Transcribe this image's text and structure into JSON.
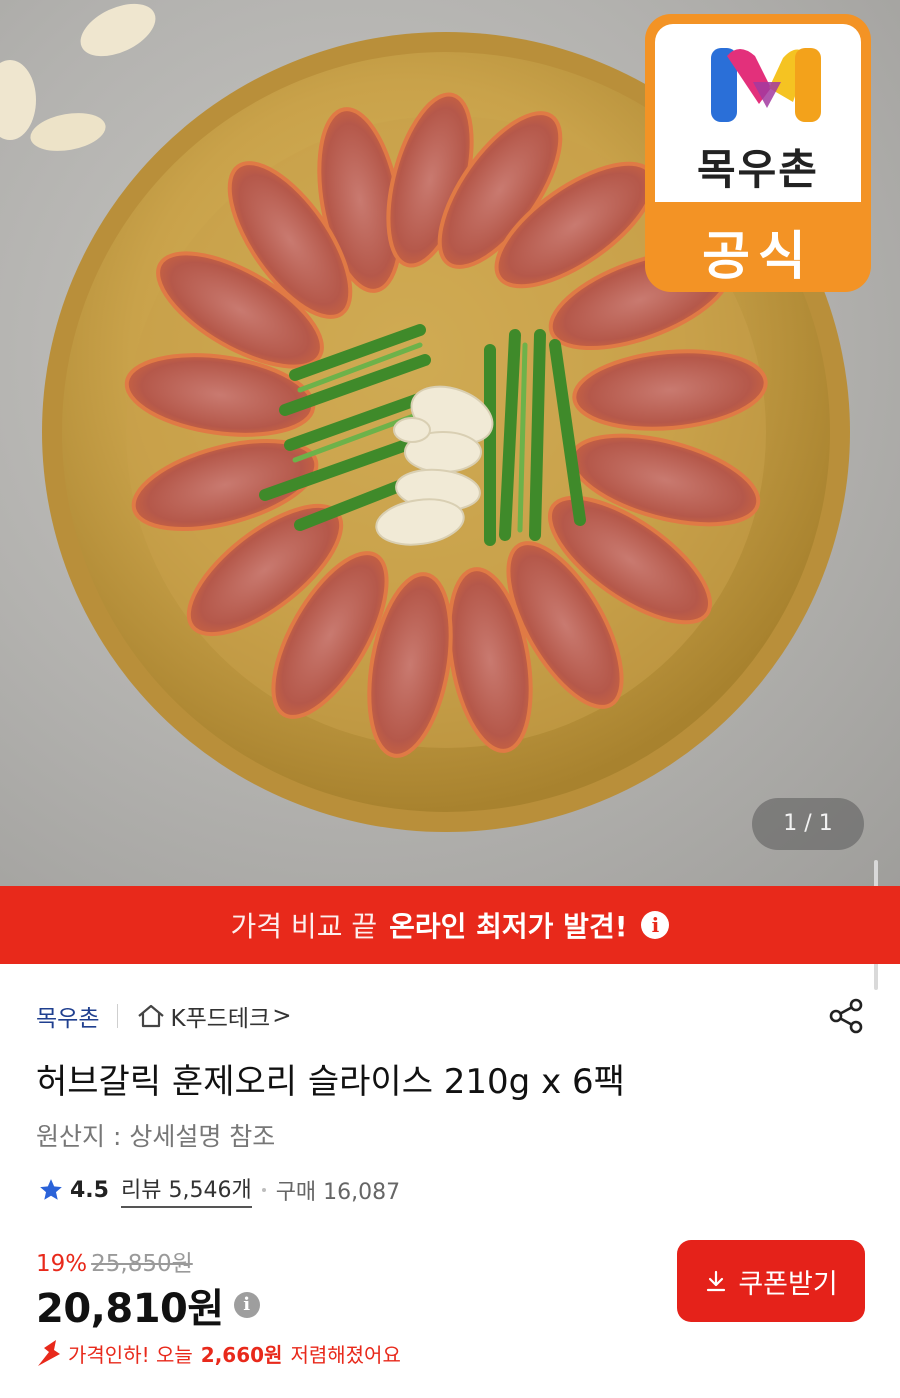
{
  "hero": {
    "badge_brand": "목우촌",
    "badge_official": "공식",
    "pager": "1 / 1"
  },
  "promo": {
    "text_light": "가격 비교 끝",
    "text_strong": "온라인 최저가 발견!",
    "info_glyph": "i"
  },
  "seller": {
    "brand": "목우촌",
    "store": "K푸드테크",
    "store_chevron": ">"
  },
  "product": {
    "title": "허브갈릭 훈제오리 슬라이스 210g x 6팩",
    "origin": "원산지 : 상세설명 참조"
  },
  "rating": {
    "score": "4.5",
    "reviews": "리뷰 5,546개",
    "purchases": "구매 16,087"
  },
  "pricing": {
    "discount_pct": "19%",
    "original_price": "25,850원",
    "price": "20,810원",
    "info_glyph": "i",
    "coupon_label": "쿠폰받기",
    "drop_prefix": "가격인하! 오늘",
    "drop_amount": "2,660원",
    "drop_suffix": "저렴해졌어요"
  },
  "colors": {
    "accent_red": "#e8291b",
    "badge_orange": "#f39325",
    "seller_blue": "#1f3f8f",
    "star_blue": "#2a62d8"
  }
}
